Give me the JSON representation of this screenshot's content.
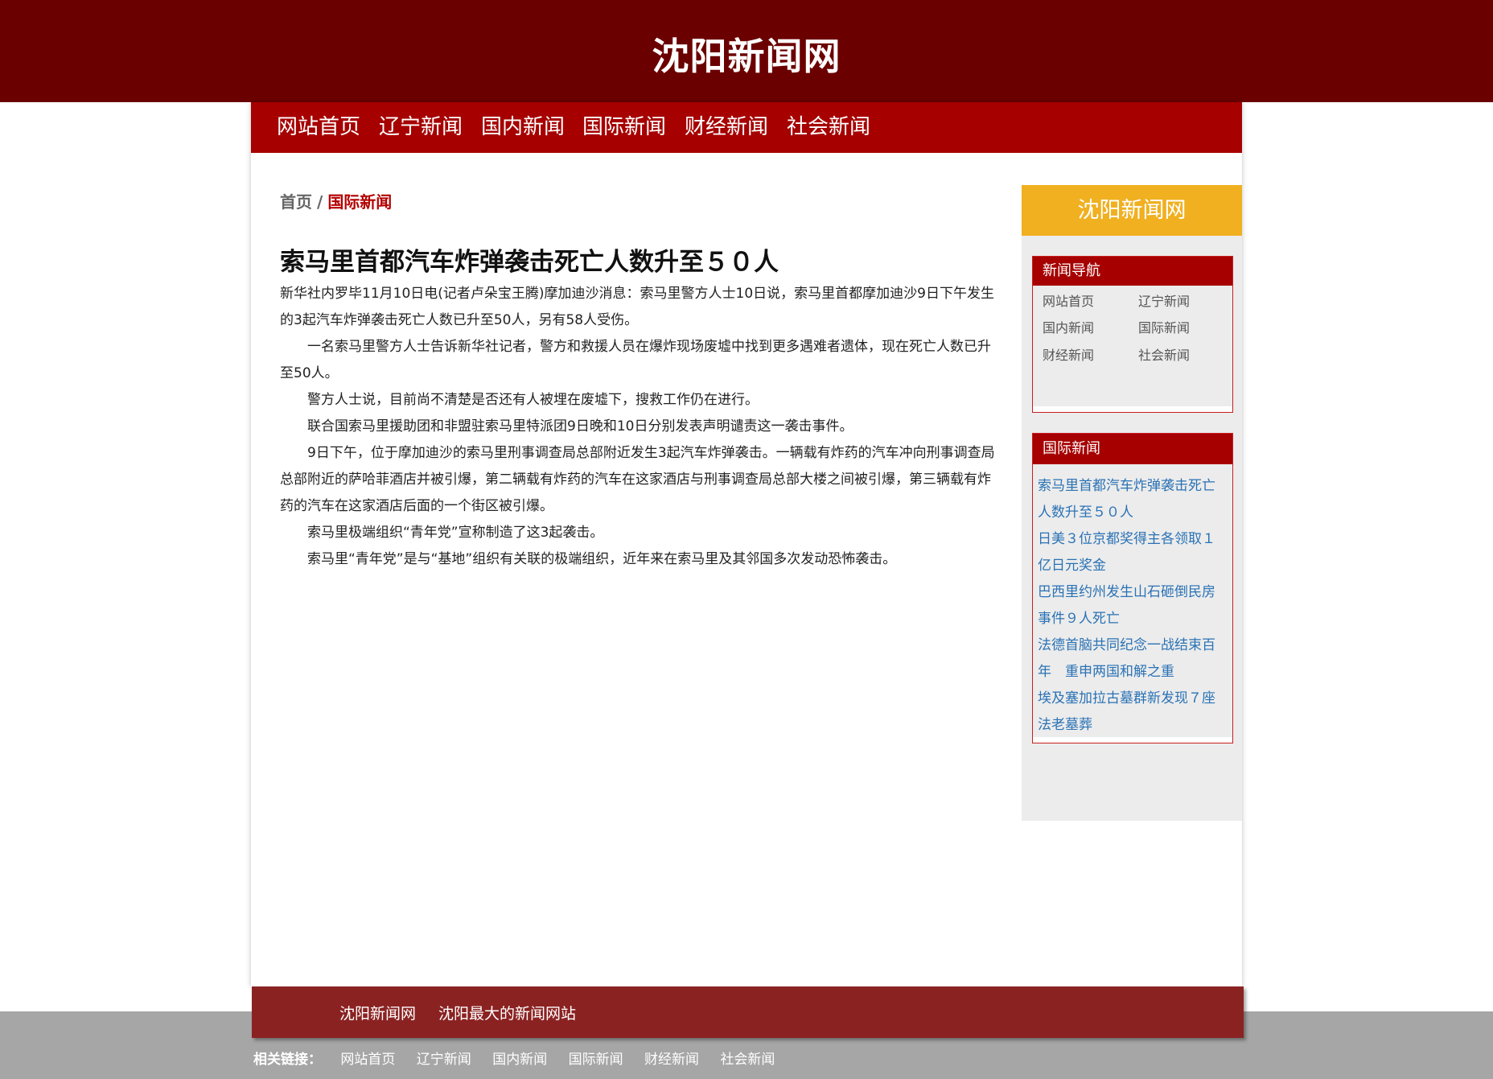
{
  "site": {
    "title": "沈阳新闻网"
  },
  "nav": {
    "items": [
      "网站首页",
      "辽宁新闻",
      "国内新闻",
      "国际新闻",
      "财经新闻",
      "社会新闻"
    ]
  },
  "breadcrumb": {
    "home": "首页",
    "separator": "/",
    "current": "国际新闻"
  },
  "article": {
    "title": "索马里首都汽车炸弹袭击死亡人数升至５０人",
    "paragraphs": [
      "新华社内罗毕11月10日电(记者卢朵宝王腾)摩加迪沙消息：索马里警方人士10日说，索马里首都摩加迪沙9日下午发生的3起汽车炸弹袭击死亡人数已升至50人，另有58人受伤。",
      "一名索马里警方人士告诉新华社记者，警方和救援人员在爆炸现场废墟中找到更多遇难者遗体，现在死亡人数已升至50人。",
      "警方人士说，目前尚不清楚是否还有人被埋在废墟下，搜救工作仍在进行。",
      "联合国索马里援助团和非盟驻索马里特派团9日晚和10日分别发表声明谴责这一袭击事件。",
      "9日下午，位于摩加迪沙的索马里刑事调查局总部附近发生3起汽车炸弹袭击。一辆载有炸药的汽车冲向刑事调查局总部附近的萨哈菲酒店并被引爆，第二辆载有炸药的汽车在这家酒店与刑事调查局总部大楼之间被引爆，第三辆载有炸药的汽车在这家酒店后面的一个街区被引爆。",
      "索马里极端组织“青年党”宣称制造了这3起袭击。",
      "索马里“青年党”是与“基地”组织有关联的极端组织，近年来在索马里及其邻国多次发动恐怖袭击。"
    ]
  },
  "sidebar": {
    "header": "沈阳新闻网",
    "nav_box": {
      "title": "新闻导航",
      "items": [
        "网站首页",
        "辽宁新闻",
        "国内新闻",
        "国际新闻",
        "财经新闻",
        "社会新闻"
      ]
    },
    "intl_box": {
      "title": "国际新闻",
      "items": [
        "索马里首都汽车炸弹袭击死亡人数升至５０人",
        "日美３位京都奖得主各领取１亿日元奖金",
        "巴西里约州发生山石砸倒民房事件９人死亡",
        "法德首脑共同纪念一战结束百年　重申两国和解之重",
        "埃及塞加拉古墓群新发现７座法老墓葬"
      ]
    }
  },
  "footer": {
    "name": "沈阳新闻网",
    "slogan": "沈阳最大的新闻网站"
  },
  "related": {
    "label": "相关链接：",
    "links": [
      "网站首页",
      "辽宁新闻",
      "国内新闻",
      "国际新闻",
      "财经新闻",
      "社会新闻"
    ]
  },
  "colors": {
    "banner": "#6b0000",
    "nav": "#a60000",
    "sidebar_header": "#f0b020",
    "link_blue": "#2a72b5",
    "footer": "#8b2222"
  }
}
